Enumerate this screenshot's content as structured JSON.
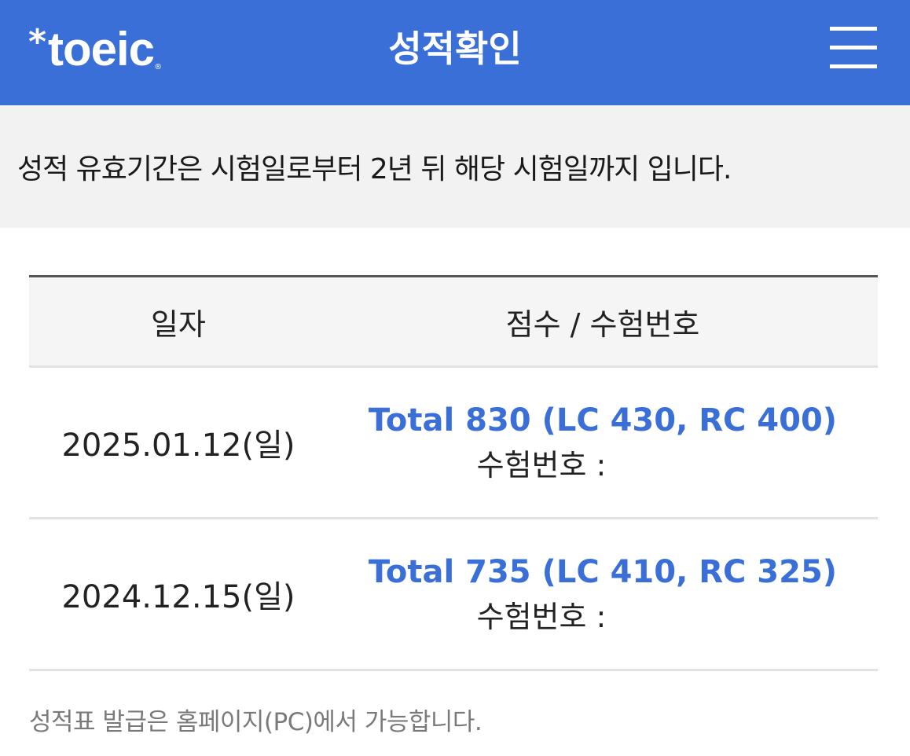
{
  "header": {
    "logo_text": "toeic",
    "logo_star": "*",
    "logo_reg": "®",
    "title": "성적확인",
    "menu_icon": "hamburger-menu-icon"
  },
  "notice": {
    "text": "성적 유효기간은 시험일로부터 2년 뒤 해당 시험일까지 입니다."
  },
  "table": {
    "headers": {
      "date": "일자",
      "score": "점수 / 수험번호"
    },
    "rows": [
      {
        "date": "2025.01.12(일)",
        "score": "Total 830 (LC 430, RC 400)",
        "exam_label": "수험번호 :"
      },
      {
        "date": "2024.12.15(일)",
        "score": "Total 735 (LC 410, RC 325)",
        "exam_label": "수험번호 :"
      }
    ]
  },
  "footer": {
    "note": "성적표 발급은 홈페이지(PC)에서 가능합니다."
  },
  "colors": {
    "brand": "#3a6fd8",
    "notice_bg": "#f2f2f2",
    "muted_text": "#7a7a7a"
  }
}
